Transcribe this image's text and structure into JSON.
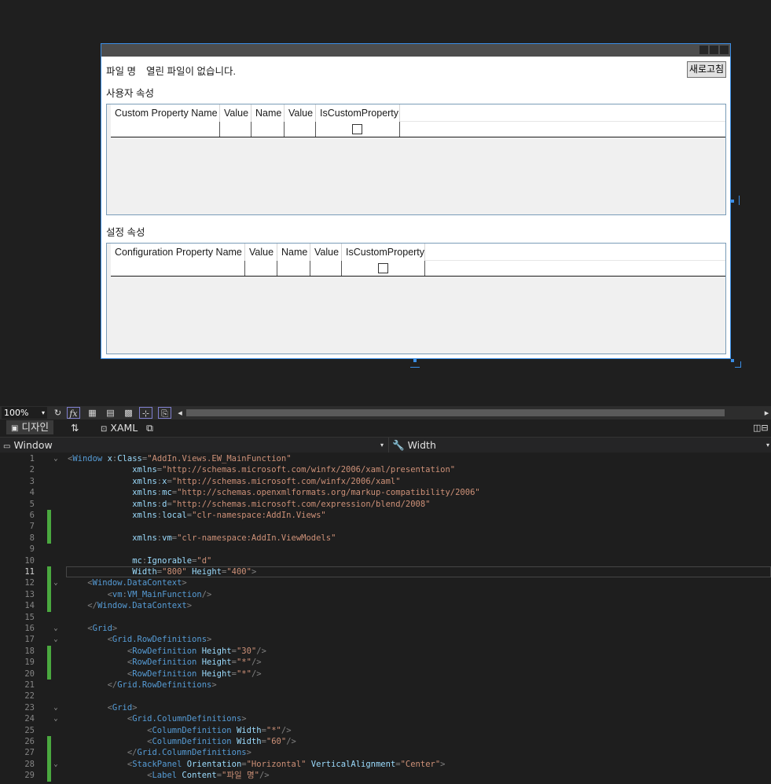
{
  "designer": {
    "file_label": "파일 명",
    "file_value": "열린 파일이 없습니다.",
    "refresh_button": "새로고침",
    "user_section_title": "사용자 속성",
    "user_grid_columns": [
      "Custom Property Name",
      "Value",
      "Name",
      "Value",
      "IsCustomProperty"
    ],
    "config_section_title": "설정 속성",
    "config_grid_columns": [
      "Configuration Property Name",
      "Value",
      "Name",
      "Value",
      "IsCustomProperty"
    ]
  },
  "toolbar": {
    "zoom": "100%",
    "icons": [
      "refresh-icon",
      "fx-icon",
      "grid-icon",
      "snap-grid-icon",
      "checker-icon",
      "snap-lines-icon",
      "device-icon"
    ]
  },
  "tabs": {
    "design": "디자인",
    "swap": "⇅",
    "xaml": "XAML"
  },
  "nav": {
    "left": "Window",
    "right": "Width"
  },
  "editor": {
    "current_line": 11,
    "lines": [
      {
        "n": "1",
        "fold": "v",
        "chg": false,
        "html": "<span class='p'>&lt;</span><span class='t'>Window</span> <span class='a'>x</span><span class='p'>:</span><span class='a'>Class</span><span class='p'>=</span><span class='s'>\"AddIn.Views.EW_MainFunction\"</span>"
      },
      {
        "n": "2",
        "fold": "",
        "chg": false,
        "html": "             <span class='a'>xmlns</span><span class='p'>=</span><span class='s'>\"http://schemas.microsoft.com/winfx/2006/xaml/presentation\"</span>"
      },
      {
        "n": "3",
        "fold": "",
        "chg": false,
        "html": "             <span class='a'>xmlns</span><span class='p'>:</span><span class='a'>x</span><span class='p'>=</span><span class='s'>\"http://schemas.microsoft.com/winfx/2006/xaml\"</span>"
      },
      {
        "n": "4",
        "fold": "",
        "chg": false,
        "html": "             <span class='a'>xmlns</span><span class='p'>:</span><span class='a'>mc</span><span class='p'>=</span><span class='s'>\"http://schemas.openxmlformats.org/markup-compatibility/2006\"</span>"
      },
      {
        "n": "5",
        "fold": "",
        "chg": false,
        "html": "             <span class='a'>xmlns</span><span class='p'>:</span><span class='a'>d</span><span class='p'>=</span><span class='s'>\"http://schemas.microsoft.com/expression/blend/2008\"</span>"
      },
      {
        "n": "6",
        "fold": "",
        "chg": true,
        "html": "             <span class='a'>xmlns</span><span class='p'>:</span><span class='a'>local</span><span class='p'>=</span><span class='s'>\"clr-namespace:AddIn.Views\"</span>"
      },
      {
        "n": "7",
        "fold": "",
        "chg": true,
        "html": ""
      },
      {
        "n": "8",
        "fold": "",
        "chg": true,
        "html": "             <span class='a'>xmlns</span><span class='p'>:</span><span class='a'>vm</span><span class='p'>=</span><span class='s'>\"clr-namespace:AddIn.ViewModels\"</span>"
      },
      {
        "n": "9",
        "fold": "",
        "chg": false,
        "html": ""
      },
      {
        "n": "10",
        "fold": "",
        "chg": false,
        "html": "             <span class='a'>mc</span><span class='p'>:</span><span class='a'>Ignorable</span><span class='p'>=</span><span class='s'>\"d\"</span>"
      },
      {
        "n": "11",
        "fold": "",
        "chg": true,
        "html": "             <span class='a'>Width</span><span class='p'>=</span><span class='s'>\"800\"</span> <span class='a'>Height</span><span class='p'>=</span><span class='s'>\"400\"</span><span class='p'>&gt;</span>"
      },
      {
        "n": "12",
        "fold": "v",
        "chg": true,
        "html": "    <span class='p'>&lt;</span><span class='t'>Window.DataContext</span><span class='p'>&gt;</span>"
      },
      {
        "n": "13",
        "fold": "",
        "chg": true,
        "html": "        <span class='p'>&lt;</span><span class='t'>vm</span><span class='p'>:</span><span class='t'>VM_MainFunction</span><span class='p'>/&gt;</span>"
      },
      {
        "n": "14",
        "fold": "",
        "chg": true,
        "html": "    <span class='p'>&lt;/</span><span class='t'>Window.DataContext</span><span class='p'>&gt;</span>"
      },
      {
        "n": "15",
        "fold": "",
        "chg": false,
        "html": ""
      },
      {
        "n": "16",
        "fold": "v",
        "chg": false,
        "html": "    <span class='p'>&lt;</span><span class='t'>Grid</span><span class='p'>&gt;</span>"
      },
      {
        "n": "17",
        "fold": "v",
        "chg": false,
        "html": "        <span class='p'>&lt;</span><span class='t'>Grid.RowDefinitions</span><span class='p'>&gt;</span>"
      },
      {
        "n": "18",
        "fold": "",
        "chg": true,
        "html": "            <span class='p'>&lt;</span><span class='t'>RowDefinition</span> <span class='a'>Height</span><span class='p'>=</span><span class='s'>\"30\"</span><span class='p'>/&gt;</span>"
      },
      {
        "n": "19",
        "fold": "",
        "chg": true,
        "html": "            <span class='p'>&lt;</span><span class='t'>RowDefinition</span> <span class='a'>Height</span><span class='p'>=</span><span class='s'>\"*\"</span><span class='p'>/&gt;</span>"
      },
      {
        "n": "20",
        "fold": "",
        "chg": true,
        "html": "            <span class='p'>&lt;</span><span class='t'>RowDefinition</span> <span class='a'>Height</span><span class='p'>=</span><span class='s'>\"*\"</span><span class='p'>/&gt;</span>"
      },
      {
        "n": "21",
        "fold": "",
        "chg": false,
        "html": "        <span class='p'>&lt;/</span><span class='t'>Grid.RowDefinitions</span><span class='p'>&gt;</span>"
      },
      {
        "n": "22",
        "fold": "",
        "chg": false,
        "html": ""
      },
      {
        "n": "23",
        "fold": "v",
        "chg": false,
        "html": "        <span class='p'>&lt;</span><span class='t'>Grid</span><span class='p'>&gt;</span>"
      },
      {
        "n": "24",
        "fold": "v",
        "chg": false,
        "html": "            <span class='p'>&lt;</span><span class='t'>Grid.ColumnDefinitions</span><span class='p'>&gt;</span>"
      },
      {
        "n": "25",
        "fold": "",
        "chg": false,
        "html": "                <span class='p'>&lt;</span><span class='t'>ColumnDefinition</span> <span class='a'>Width</span><span class='p'>=</span><span class='s'>\"*\"</span><span class='p'>/&gt;</span>"
      },
      {
        "n": "26",
        "fold": "",
        "chg": true,
        "html": "                <span class='p'>&lt;</span><span class='t'>ColumnDefinition</span> <span class='a'>Width</span><span class='p'>=</span><span class='s'>\"60\"</span><span class='p'>/&gt;</span>"
      },
      {
        "n": "27",
        "fold": "",
        "chg": true,
        "html": "            <span class='p'>&lt;/</span><span class='t'>Grid.ColumnDefinitions</span><span class='p'>&gt;</span>"
      },
      {
        "n": "28",
        "fold": "v",
        "chg": true,
        "html": "            <span class='p'>&lt;</span><span class='t'>StackPanel</span> <span class='a'>Orientation</span><span class='p'>=</span><span class='s'>\"Horizontal\"</span> <span class='a'>VerticalAlignment</span><span class='p'>=</span><span class='s'>\"Center\"</span><span class='p'>&gt;</span>"
      },
      {
        "n": "29",
        "fold": "",
        "chg": true,
        "html": "                <span class='p'>&lt;</span><span class='t'>Label</span> <span class='a'>Content</span><span class='p'>=</span><span class='s'>\"파일 명\"</span><span class='p'>/&gt;</span>"
      }
    ]
  }
}
